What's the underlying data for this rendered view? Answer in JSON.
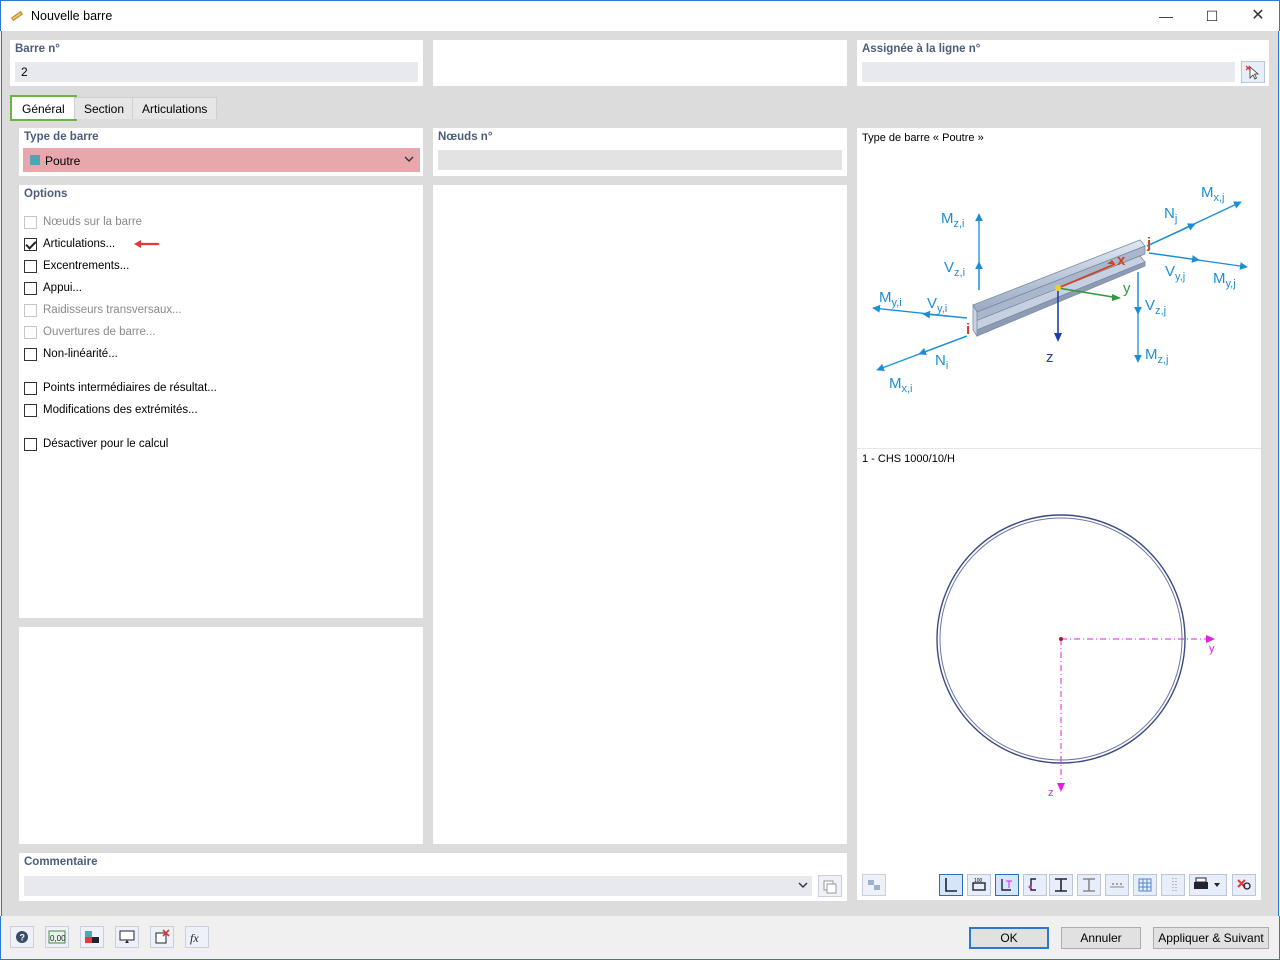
{
  "window": {
    "title": "Nouvelle barre"
  },
  "header": {
    "member_no_label": "Barre n°",
    "member_no_value": "2",
    "assigned_label": "Assignée à la ligne n°",
    "assigned_value": ""
  },
  "tabs": [
    {
      "label": "Général",
      "active": true
    },
    {
      "label": "Section",
      "active": false
    },
    {
      "label": "Articulations",
      "active": false
    }
  ],
  "member_type": {
    "label": "Type de barre",
    "value": "Poutre",
    "swatch_color": "#4fa6b2",
    "highlight_color": "#e8a6ad"
  },
  "nodes": {
    "label": "Nœuds n°",
    "value": ""
  },
  "options": {
    "label": "Options",
    "items": [
      {
        "label": "Nœuds sur la barre",
        "checked": false,
        "enabled": false
      },
      {
        "label": "Articulations...",
        "checked": true,
        "enabled": true
      },
      {
        "label": "Excentrements...",
        "checked": false,
        "enabled": true
      },
      {
        "label": "Appui...",
        "checked": false,
        "enabled": true
      },
      {
        "label": "Raidisseurs transversaux...",
        "checked": false,
        "enabled": false
      },
      {
        "label": "Ouvertures de barre...",
        "checked": false,
        "enabled": false
      },
      {
        "label": "Non-linéarité...",
        "checked": false,
        "enabled": true
      },
      {
        "label": "Points intermédiaires de résultat...",
        "checked": false,
        "enabled": true
      },
      {
        "label": "Modifications des extrémités...",
        "checked": false,
        "enabled": true
      },
      {
        "label": "Désactiver pour le calcul",
        "checked": false,
        "enabled": true
      }
    ]
  },
  "comment": {
    "label": "Commentaire",
    "value": ""
  },
  "preview": {
    "member_title": "Type de barre « Poutre »",
    "section_title": "1 - CHS 1000/10/H",
    "diagram_labels": {
      "mzi": "M",
      "mzi_sub": "z,i",
      "vzi": "V",
      "vzi_sub": "z,i",
      "myi": "M",
      "myi_sub": "y,i",
      "vyi": "V",
      "vyi_sub": "y,i",
      "ni": "N",
      "ni_sub": "i",
      "mxi": "M",
      "mxi_sub": "x,i",
      "nj": "N",
      "nj_sub": "j",
      "mxj": "M",
      "mxj_sub": "x,j",
      "vyj": "V",
      "vyj_sub": "y,j",
      "myj": "M",
      "myj_sub": "y,j",
      "vzj": "V",
      "vzj_sub": "z,j",
      "mzj": "M",
      "mzj_sub": "z,j",
      "node_i": "i",
      "node_j": "j",
      "axis_x": "x",
      "axis_y": "y",
      "axis_z": "z"
    },
    "section_axes": {
      "y": "y",
      "z": "z"
    }
  },
  "footer_buttons": {
    "ok": "OK",
    "cancel": "Annuler",
    "apply_next": "Appliquer & Suivant"
  },
  "footer_icons": [
    "help-icon",
    "units-icon",
    "view-icon",
    "display-icon",
    "delete-icon",
    "function-icon"
  ],
  "bottom_icon_texts": {
    "units": "0,00"
  },
  "colors": {
    "accent": "#2b79d0",
    "active_tab": "#6cb33f",
    "arrow_blue": "#1c8fd4",
    "axis_magenta": "#e020e0",
    "annotation_red": "#e03a3a"
  }
}
